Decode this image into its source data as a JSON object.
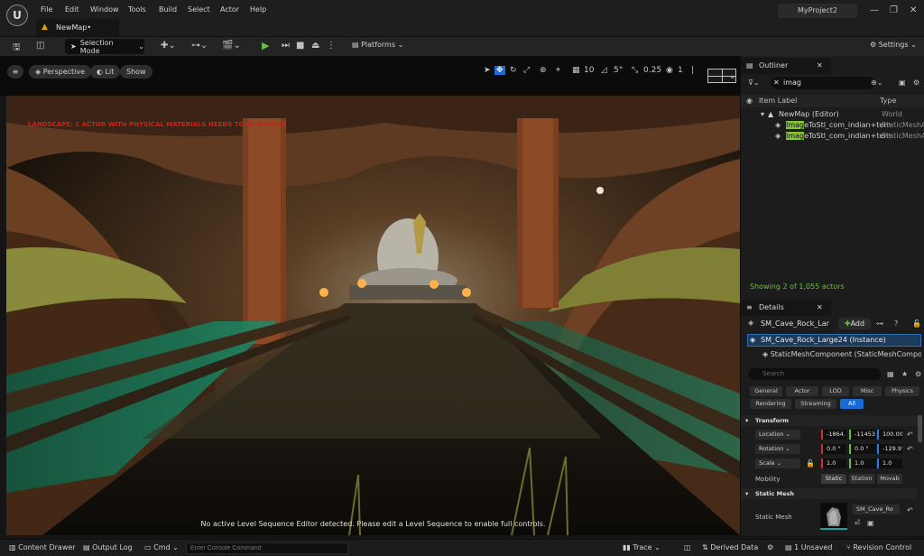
{
  "menu": [
    "File",
    "Edit",
    "Window",
    "Tools",
    "Build",
    "Select",
    "Actor",
    "Help"
  ],
  "project_name": "MyProject2",
  "map_tab": "NewMap•",
  "toolbar": {
    "selection_mode": "Selection Mode",
    "platforms": "Platforms",
    "settings": "Settings"
  },
  "viewport": {
    "perspective": "Perspective",
    "lit": "Lit",
    "show": "Show",
    "grid_snap": "10",
    "rot_snap": "5°",
    "scale_snap": "0.25",
    "camera_speed": "1",
    "error_msg": "LANDSCAPE: 1 ACTOR WITH PHYSICAL MATERIALS NEEDS TO BE REBUILT",
    "sequence_msg": "No active Level Sequence Editor detected. Please edit a Level Sequence to enable full controls."
  },
  "outliner": {
    "title": "Outliner",
    "search_value": "imag",
    "col_label": "Item Label",
    "col_type": "Type",
    "rows": [
      {
        "label": "NewMap (Editor)",
        "type": "World"
      },
      {
        "hl": "Imag",
        "rest": "eToStl_com_indian+tem",
        "type": "StaticMeshAc"
      },
      {
        "hl": "Imag",
        "rest": "eToStl_com_indian+tem",
        "type": "StaticMeshAc"
      }
    ],
    "showing": "Showing 2 of 1,055 actors"
  },
  "details": {
    "title": "Details",
    "actor_name": "SM_Cave_Rock_Lar",
    "add": "Add",
    "instance": "SM_Cave_Rock_Large24 (Instance)",
    "component": "StaticMeshComponent (StaticMeshComponer",
    "search_placeholder": "Search",
    "cats_row1": [
      "General",
      "Actor",
      "LOD",
      "Misc",
      "Physics"
    ],
    "cats_row2": [
      "Rendering",
      "Streaming",
      "All"
    ],
    "transform_hdr": "Transform",
    "location": "Location",
    "loc": [
      "-1864.",
      "-11453",
      "100.00"
    ],
    "rotation": "Rotation",
    "rot": [
      "0.0 °",
      "0.0 °",
      "-129.9°"
    ],
    "scale": "Scale",
    "scl": [
      "1.0",
      "1.0",
      "1.0"
    ],
    "mobility": "Mobility",
    "mob": [
      "Static",
      "Station",
      "Movab"
    ],
    "static_mesh_hdr": "Static Mesh",
    "static_mesh_lbl": "Static Mesh",
    "mesh_value": "SM_Cave_Ro"
  },
  "statusbar": {
    "content_drawer": "Content Drawer",
    "output_log": "Output Log",
    "cmd": "Cmd",
    "console_placeholder": "Enter Console Command",
    "trace": "Trace",
    "derived_data": "Derived Data",
    "unsaved": "1 Unsaved",
    "revision": "Revision Control"
  }
}
